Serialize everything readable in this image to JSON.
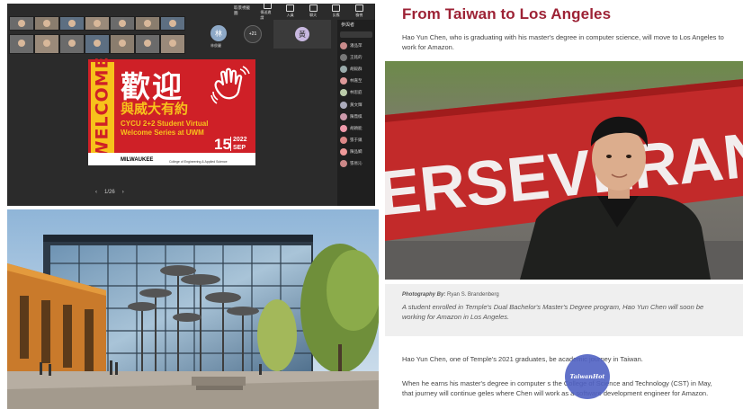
{
  "meeting": {
    "toolbar": {
      "time": "取景視截圖",
      "items": [
        "傳送邀請",
        "入員",
        "聊天",
        "反應",
        "檢視",
        "其他"
      ],
      "leave": "離開"
    },
    "participants_panel": {
      "title": "參與者",
      "names": [
        "潘品萍",
        "王銘的",
        "胡毅群",
        "林嘉至",
        "林思庭",
        "黃文輝",
        "陳鼎棋",
        "胡穎能",
        "張于鎮",
        "陳品嫻",
        "張易沁"
      ]
    },
    "avatars": {
      "a1": "林",
      "a1_name": "林俊麗",
      "a2": "+21",
      "a3": "黃"
    },
    "pager": {
      "prev": "‹",
      "page": "1/26",
      "next": "›"
    },
    "poster": {
      "vertical_word": "WELCOME",
      "chinese_big": "歡迎",
      "chinese_sub": "與威大有約",
      "line1": "CYCU 2+2 Student Virtual",
      "line2": "Welcome Series at UWM",
      "day": "15",
      "year": "2022",
      "month": "SEP",
      "footer_logo": "MILWAUKEE",
      "footer_text": "College of Engineering & Applied Science"
    }
  },
  "article": {
    "title": "From Taiwan to Los Angeles",
    "lede": "Hao Yun Chen, who is graduating with his master's degree in computer science, will move to Los Angeles to work for Amazon.",
    "banner_text": "ERSEVERANCE",
    "credit_label": "Photography By:",
    "credit_name": "Ryan S. Brandenberg",
    "caption": "A student enrolled in Temple's Dual Bachelor's Master's Degree program, Hao Yun Chen will soon be working for Amazon in Los Angeles.",
    "body1": "Hao Yun Chen, one of Temple's 2021 graduates, be        academic journey in Taiwan.",
    "body2": "When he earns his master's degree in computer s         the College of Science and Technology (CST) in May, that journey will continue        geles where Chen will work as a software development engineer for Amazon."
  },
  "watermark": "TaiwanHot"
}
